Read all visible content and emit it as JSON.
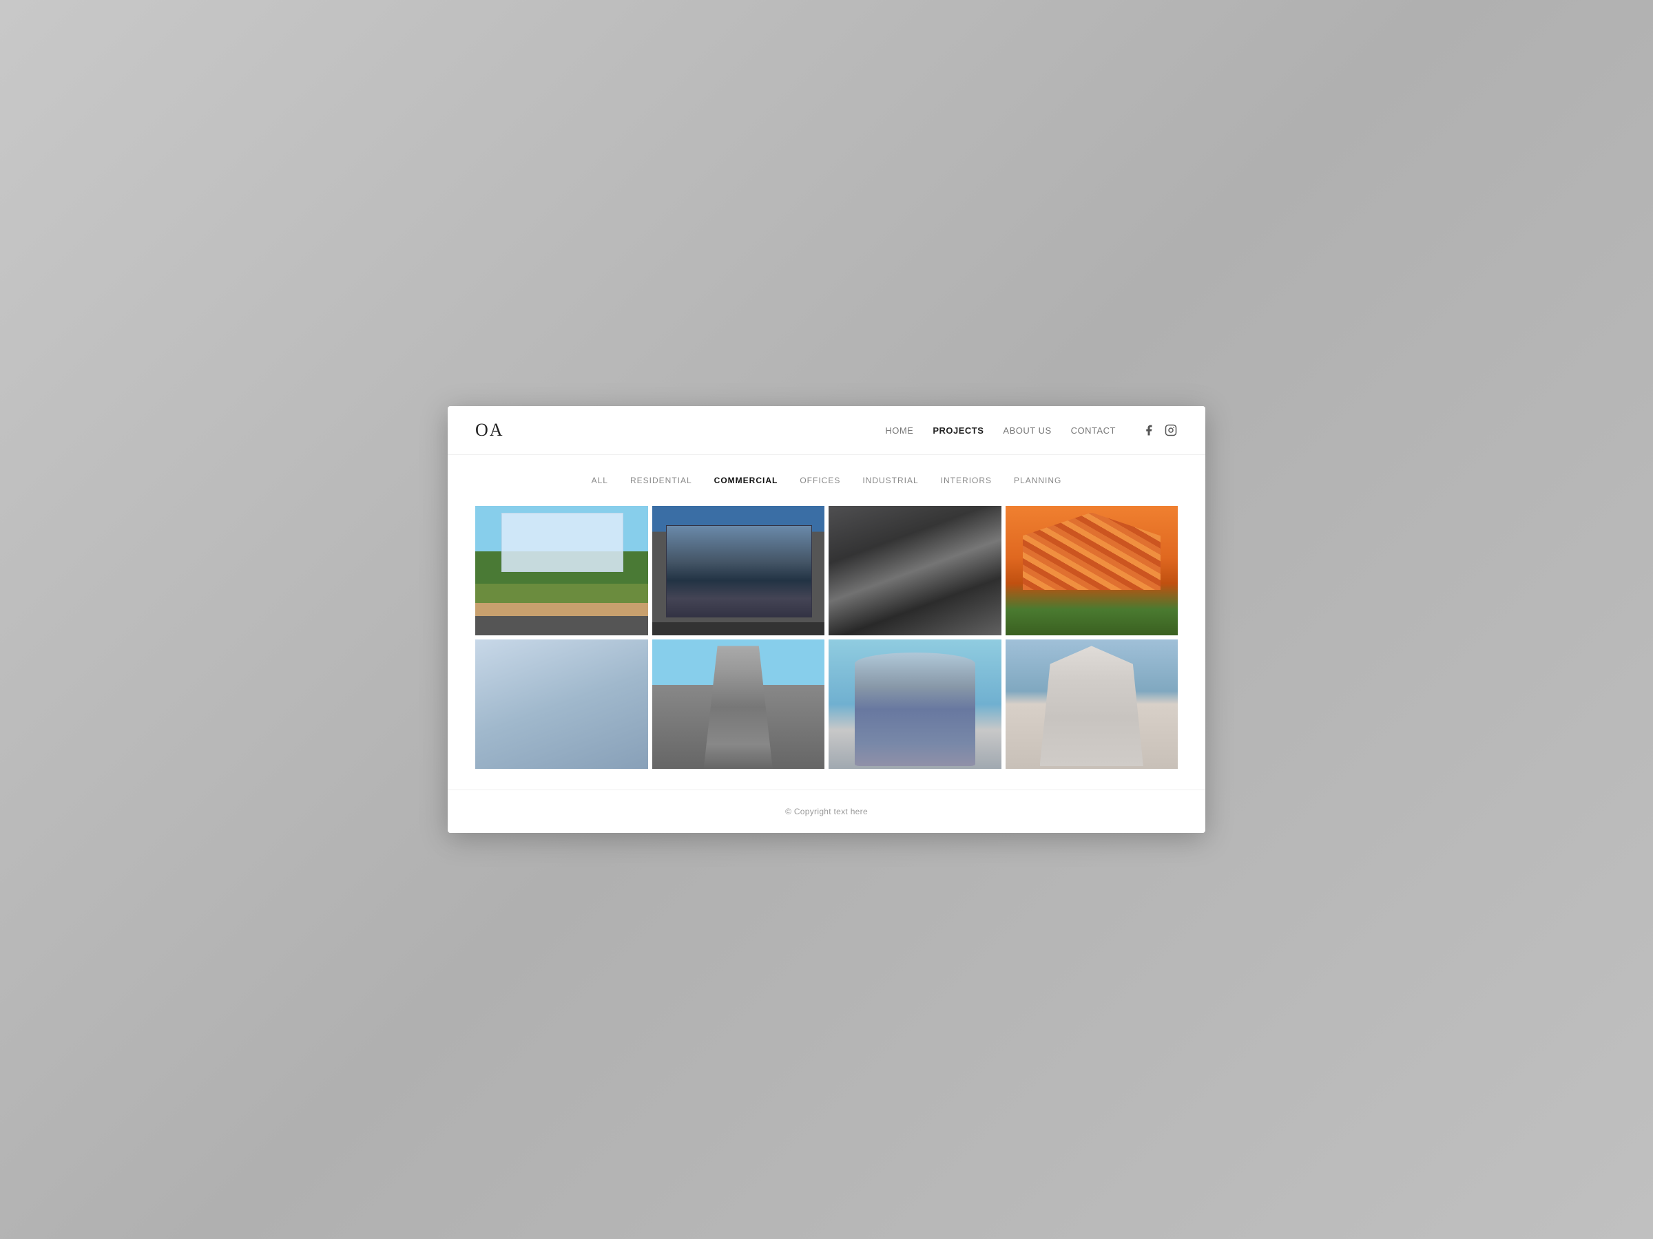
{
  "header": {
    "logo": "OA",
    "nav": {
      "items": [
        {
          "label": "HOME",
          "active": false
        },
        {
          "label": "PROJECTS",
          "active": true
        },
        {
          "label": "ABOUT US",
          "active": false
        },
        {
          "label": "CONTACT",
          "active": false
        }
      ]
    },
    "social": [
      {
        "name": "facebook-icon"
      },
      {
        "name": "instagram-icon"
      }
    ]
  },
  "filter": {
    "items": [
      {
        "label": "All",
        "active": false
      },
      {
        "label": "RESIDENTIAL",
        "active": false
      },
      {
        "label": "COMMERCIAL",
        "active": true
      },
      {
        "label": "OFFICES",
        "active": false
      },
      {
        "label": "INDUSTRIAL",
        "active": false
      },
      {
        "label": "INTERIORS",
        "active": false
      },
      {
        "label": "PLANNING",
        "active": false
      }
    ]
  },
  "grid": {
    "items": [
      {
        "id": 1,
        "alt": "Commercial building aerial view"
      },
      {
        "id": 2,
        "alt": "Nike retail store facade"
      },
      {
        "id": 3,
        "alt": "Shopping mall interior escalators"
      },
      {
        "id": 4,
        "alt": "Geometric orange building facade"
      },
      {
        "id": 5,
        "alt": "Modern angular building facade"
      },
      {
        "id": 6,
        "alt": "Tall pointed modern tower"
      },
      {
        "id": 7,
        "alt": "Curved modern office tower"
      },
      {
        "id": 8,
        "alt": "White geometric pyramid building"
      }
    ]
  },
  "footer": {
    "copyright": "© Copyright text here"
  }
}
